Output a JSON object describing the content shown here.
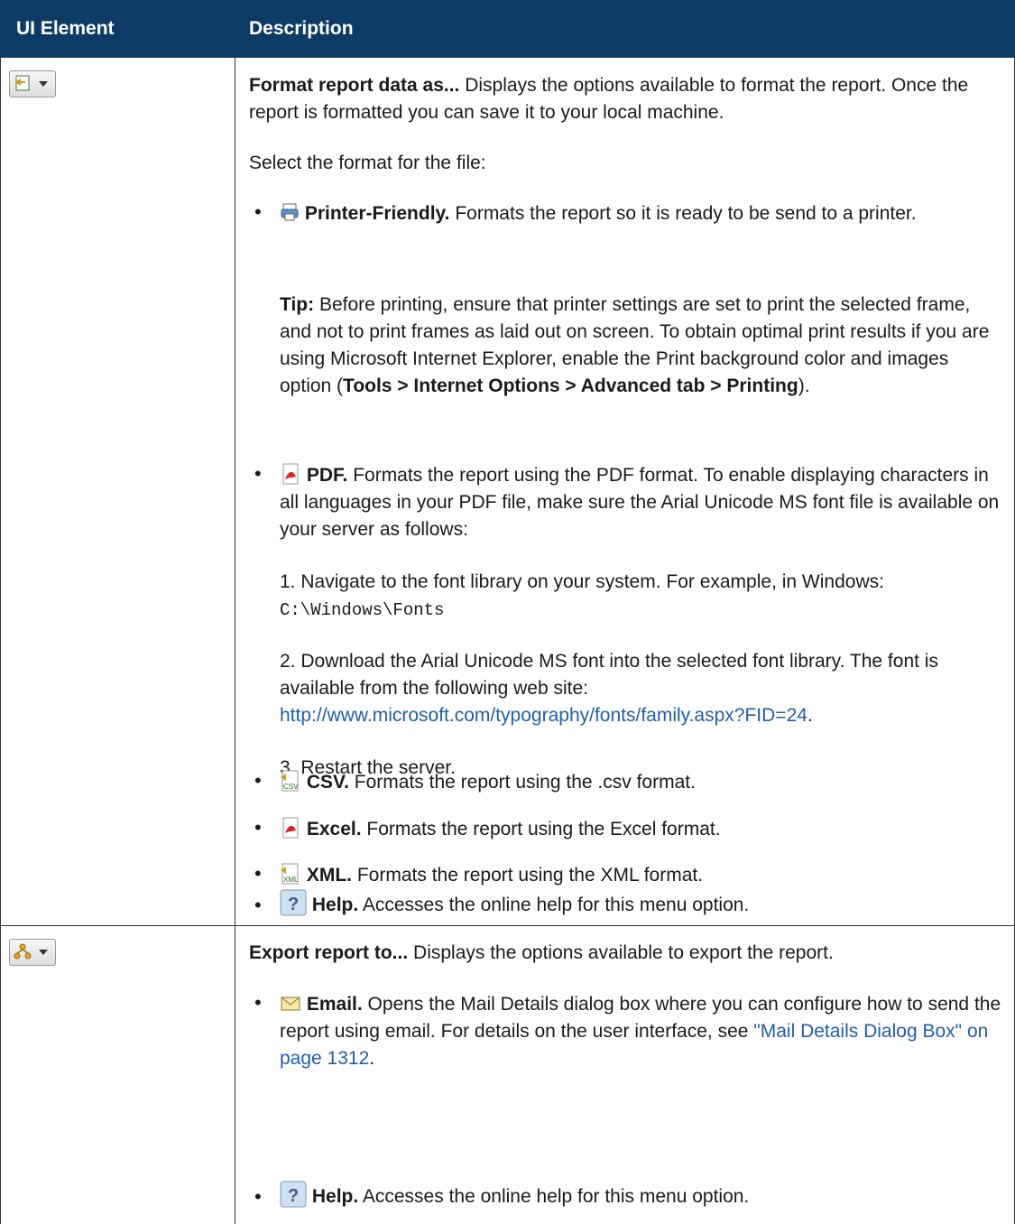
{
  "table": {
    "header": {
      "col1": "UI Element",
      "col2": "Description"
    }
  },
  "row1": {
    "format_title": "Format report data as...",
    "format_desc": " Displays the options available to format the report. Once the report is formatted you can save it to your local machine.",
    "select_format": "Select the format for the file:",
    "printer_title": "Printer-Friendly.",
    "printer_desc": " Formats the report so it is ready to be send to a printer.",
    "tip_label": "Tip:",
    "tip_text": " Before printing, ensure that printer settings are set to print the selected frame, and not to print frames as laid out on screen. To obtain optimal print results if you are using Microsoft Internet Explorer, enable the Print background color and images option (",
    "tip_bold": "Tools > Internet Options > Advanced tab > Printing",
    "tip_end": ").",
    "pdf_title": "PDF.",
    "pdf_desc": " Formats the report using the PDF format. To enable displaying characters in all languages in your PDF file, make sure the Arial Unicode MS font file is available on your server as follows:",
    "step1_text": "1. Navigate to the font library on your system. For example, in Windows: ",
    "step1_path": "C:\\Windows\\Fonts",
    "step2_text": "2. Download the Arial Unicode MS font into the selected font library. The font is available from the following web site: ",
    "step2_link": "http://www.microsoft.com/typography/fonts/family.aspx?FID=24",
    "step2_end": ".",
    "step3_text": "3. Restart the server.",
    "csv_title": "CSV.",
    "csv_desc": " Formats the report using the .csv format.",
    "excel_title": "Excel.",
    "excel_desc": " Formats the report using the Excel format.",
    "xml_title": "XML.",
    "xml_desc": " Formats the report using the XML format.",
    "help_title": "Help.",
    "help_desc": " Accesses the online help for this menu option."
  },
  "row2": {
    "export_title": "Export report to...",
    "export_desc": " Displays the options available to export the report.",
    "email_title": "Email.",
    "email_desc": " Opens the Mail Details dialog box where you can configure how to send the report using email. For details on the user interface, see ",
    "email_link": "\"Mail Details Dialog Box\" on page 1312",
    "email_end": ".",
    "help_title": "Help.",
    "help_desc": " Accesses the online help for this menu option."
  },
  "colors": {
    "header_bg": "#0d3b66",
    "link": "#1f5fa8"
  }
}
